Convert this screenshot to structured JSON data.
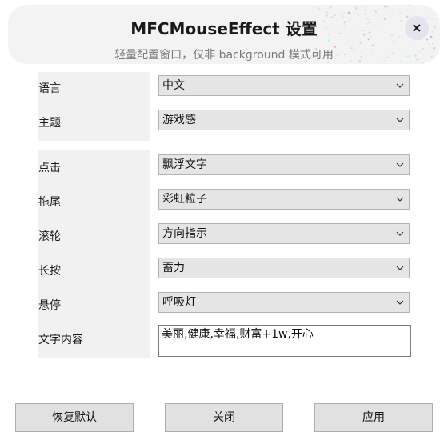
{
  "header": {
    "title": "MFCMouseEffect 设置",
    "subtitle": "轻量配置窗口，仅非 background 模式可用",
    "close_label": "×"
  },
  "general": {
    "language": {
      "label": "语言",
      "value": "中文"
    },
    "theme": {
      "label": "主题",
      "value": "游戏感"
    }
  },
  "effects": {
    "click": {
      "label": "点击",
      "value": "飘浮文字"
    },
    "trail": {
      "label": "拖尾",
      "value": "彩虹粒子"
    },
    "scroll": {
      "label": "滚轮",
      "value": "方向指示"
    },
    "long_press": {
      "label": "长按",
      "value": "蓄力"
    },
    "hover": {
      "label": "悬停",
      "value": "呼吸灯"
    },
    "text_content": {
      "label": "文字内容",
      "value": "美丽,健康,幸福,财富+1w,开心"
    }
  },
  "footer": {
    "reset_label": "恢复默认",
    "close_label": "关闭",
    "apply_label": "应用"
  },
  "icons": {
    "dropdown": "chevron-down-icon",
    "close": "close-icon"
  },
  "colors": {
    "header_bg": "#f3f3f3",
    "close_bg": "#e4e4ee",
    "label_column_bg": "#f1f1f1",
    "select_bg": "#e5e5e5",
    "button_bg": "#e1e1e1"
  }
}
